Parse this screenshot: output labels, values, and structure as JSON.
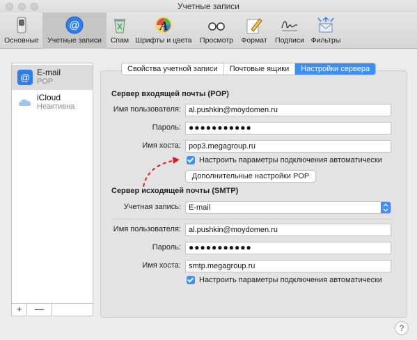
{
  "window": {
    "title": "Учетные записи"
  },
  "toolbar": {
    "items": [
      {
        "label": "Основные",
        "icon": "switch-icon"
      },
      {
        "label": "Учетные записи",
        "icon": "at-sign-icon"
      },
      {
        "label": "Спам",
        "icon": "trash-icon"
      },
      {
        "label": "Шрифты и цвета",
        "icon": "fonts-colors-icon"
      },
      {
        "label": "Просмотр",
        "icon": "glasses-icon"
      },
      {
        "label": "Формат",
        "icon": "pencil-icon"
      },
      {
        "label": "Подписи",
        "icon": "signature-icon"
      },
      {
        "label": "Фильтры",
        "icon": "filters-icon"
      }
    ]
  },
  "accounts": [
    {
      "name": "E-mail",
      "sub": "POP"
    },
    {
      "name": "iCloud",
      "sub": "Неактивна"
    }
  ],
  "sidebar_buttons": {
    "add": "+",
    "remove": "—"
  },
  "tabs": [
    "Свойства учетной записи",
    "Почтовые ящики",
    "Настройки сервера"
  ],
  "incoming": {
    "title": "Сервер входящей почты (POP)",
    "username_label": "Имя пользователя:",
    "username": "al.pushkin@moydomen.ru",
    "password_label": "Пароль:",
    "password": "●●●●●●●●●●●",
    "host_label": "Имя хоста:",
    "host": "pop3.megagroup.ru",
    "auto_label": "Настроить параметры подключения автоматически",
    "advanced_button": "Дополнительные настройки POP"
  },
  "outgoing": {
    "title": "Сервер исходящей почты (SMTP)",
    "account_label": "Учетная запись:",
    "account": "E-mail",
    "username_label": "Имя пользователя:",
    "username": "al.pushkin@moydomen.ru",
    "password_label": "Пароль:",
    "password": "●●●●●●●●●●●",
    "host_label": "Имя хоста:",
    "host": "smtp.megagroup.ru",
    "auto_label": "Настроить параметры подключения автоматически"
  },
  "help": "?",
  "colors": {
    "accent": "#3f8ef4",
    "annotation": "#e02020"
  }
}
